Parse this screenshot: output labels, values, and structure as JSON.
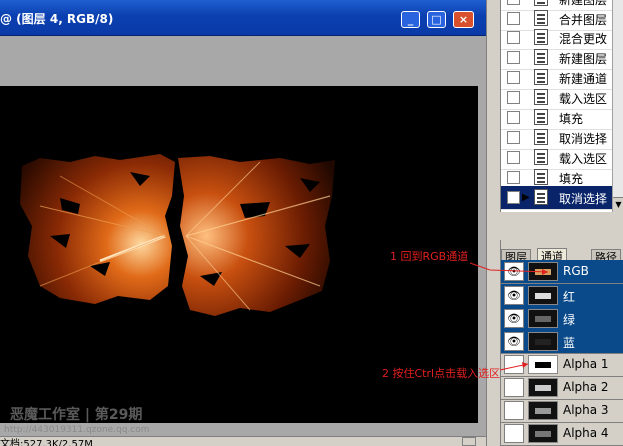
{
  "document": {
    "title": "@ (图层 4, RGB/8)",
    "window_buttons": {
      "minimize": "_",
      "maximize": "□",
      "close": "×"
    },
    "status": "文档:527.3K/2.57M",
    "watermark": "恶魔工作室 | 第29期",
    "watermark_url": "http://443019311.qzone.qq.com"
  },
  "history": {
    "items": [
      {
        "label": "新建图层"
      },
      {
        "label": "合并图层"
      },
      {
        "label": "混合更改"
      },
      {
        "label": "新建图层"
      },
      {
        "label": "新建通道"
      },
      {
        "label": "载入选区"
      },
      {
        "label": "填充"
      },
      {
        "label": "取消选择"
      },
      {
        "label": "载入选区"
      },
      {
        "label": "填充"
      },
      {
        "label": "取消选择",
        "active": true
      }
    ]
  },
  "channels": {
    "tabs": [
      "图层",
      "通道",
      "路径"
    ],
    "selected_tab": "通道",
    "rows": [
      {
        "label": "RGB",
        "visible": true,
        "selected": true
      },
      {
        "label": "红",
        "visible": true,
        "selected": true
      },
      {
        "label": "绿",
        "visible": true,
        "selected": true
      },
      {
        "label": "蓝",
        "visible": true,
        "selected": true
      },
      {
        "label": "Alpha 1",
        "visible": false,
        "selected": false
      },
      {
        "label": "Alpha 2",
        "visible": false,
        "selected": false
      },
      {
        "label": "Alpha 3",
        "visible": false,
        "selected": false
      },
      {
        "label": "Alpha 4",
        "visible": false,
        "selected": false
      }
    ],
    "eye_icon": "eye-icon"
  },
  "annotations": {
    "step1": "1 回到RGB通道",
    "step2": "2 按住Ctrl点击载入选区"
  },
  "colors": {
    "title_bar": "#0a3aa8",
    "selection": "#0a4a8a",
    "annotation": "#e02020",
    "artwork_orange": "#c85010"
  }
}
